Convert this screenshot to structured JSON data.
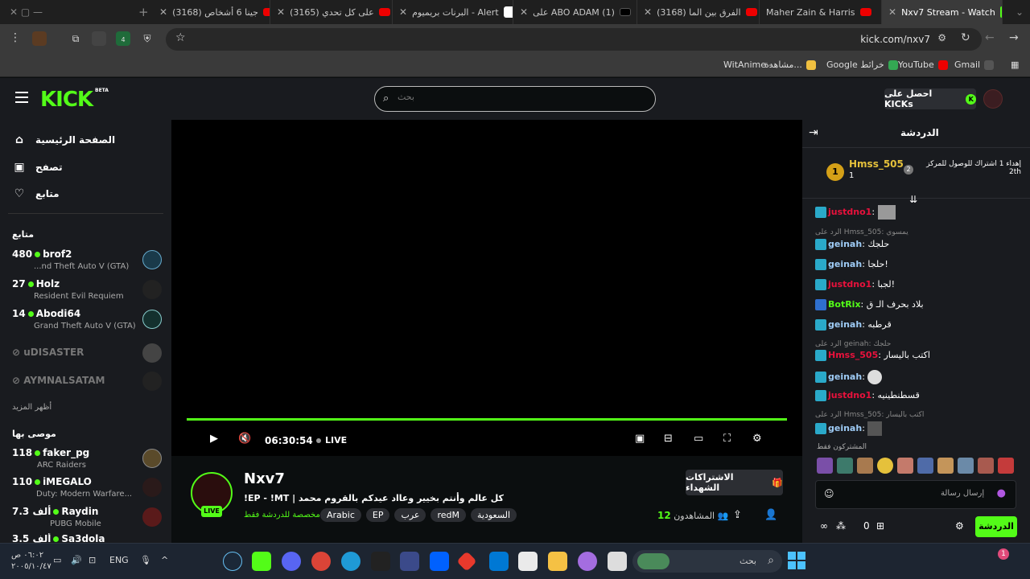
{
  "browser": {
    "tabs": [
      {
        "label": "جينا 6 أشخاص (3168)",
        "icon": "youtube-icon"
      },
      {
        "label": "على كل تحدي (3165)",
        "icon": "youtube-icon"
      },
      {
        "label": "البرنات بريميوم - Alert",
        "icon": "app-icon"
      },
      {
        "label": "على ABO ADAM (1)",
        "icon": "x-icon"
      },
      {
        "label": "الفرق بين الما (3168)",
        "icon": "youtube-icon"
      },
      {
        "label": "Maher Zain & Harris",
        "icon": "youtube-icon"
      },
      {
        "label": "Nxv7 Stream - Watch",
        "icon": "kick-icon"
      }
    ],
    "url": "kick.com/nxv7",
    "extension_badge": "4",
    "bookmarks": [
      {
        "label": "Gmail"
      },
      {
        "label": "YouTube"
      },
      {
        "label": "Google خرائط"
      },
      {
        "label": "مشاهدة..."
      },
      {
        "label": "WitAnime -"
      }
    ]
  },
  "kick": {
    "logo": "KICK",
    "beta": "BETA",
    "search_placeholder": "بحث",
    "get_kicks": "احصل على KICKs",
    "nav": {
      "home": "الصفحة الرئيسية",
      "browse": "تصفح",
      "following": "متابع"
    },
    "following_header": "متابع",
    "following": [
      {
        "count": "480",
        "name": "brof2",
        "game": "...nd Theft Auto V (GTA)"
      },
      {
        "count": "27",
        "name": "Holz",
        "game": "Resident Evil Requiem"
      },
      {
        "count": "14",
        "name": "Abodi64",
        "game": "Grand Theft Auto V (GTA)"
      }
    ],
    "offline": [
      "uDISASTER",
      "AYMNALSATAM"
    ],
    "show_more": "أظهر المزيد",
    "recommended_header": "موصى بها",
    "recommended": [
      {
        "count": "118",
        "name": "faker_pg",
        "game": "ARC Raiders"
      },
      {
        "count": "110",
        "name": "iMEGALO",
        "game": "Duty: Modern Warfare..."
      },
      {
        "count": "7.3 ألف",
        "name": "Raydin",
        "game": "PUBG Mobile"
      },
      {
        "count": "3.5 ألف",
        "name": "Sa3dola",
        "game": ""
      }
    ],
    "player": {
      "time": "06:30:54",
      "live": "LIVE"
    },
    "stream": {
      "name": "Nxv7",
      "live_tag": "LIVE",
      "title": "!EP - !MT | كل عالم وأنتم بخيير وعااد عيدكم بالقروم محمد",
      "chat_mode": "مخصصة للدردشة فقط",
      "tags": [
        "السعودية",
        "redM",
        "عرب",
        "EP",
        "Arabic"
      ],
      "subscribe": "الاشتراكات الشهداء",
      "viewers_label": "المشاهدون",
      "viewers": "12"
    },
    "chat": {
      "title": "الدردشة",
      "pinned_user": "Hmss_505",
      "pinned_count": "1",
      "pinned_rank": "2",
      "pinned_text": "إهداء 1 اشتراك للوصول للمركز 2th",
      "messages": [
        {
          "user": "justdno1",
          "text": "",
          "color": "#e9113c"
        },
        {
          "reply": "الرد على Hmss_505: يمسوي"
        },
        {
          "user": "geinah",
          "text": "حلجك",
          "color": "#9ecbf5"
        },
        {
          "user": "geinah",
          "text": "حلجا!",
          "color": "#9ecbf5"
        },
        {
          "user": "justdno1",
          "text": "لجبا!",
          "color": "#e9113c"
        },
        {
          "user": "BotRix",
          "text": "بلاد بحرف الـ ق",
          "color": "#53fc18"
        },
        {
          "user": "geinah",
          "text": "قرطبه",
          "color": "#9ecbf5"
        },
        {
          "reply": "الرد على geinah: حلجك"
        },
        {
          "user": "Hmss_505",
          "text": "اكتب باليسار",
          "color": "#e9113c"
        },
        {
          "user": "geinah",
          "text": "",
          "color": "#9ecbf5"
        },
        {
          "user": "justdno1",
          "text": "قسطنطينيه",
          "color": "#e9113c"
        },
        {
          "reply": "الرد على Hmss_505: اكتب باليسار"
        },
        {
          "user": "geinah",
          "text": "",
          "color": "#9ecbf5"
        }
      ],
      "subs_label": "المشتركون فقط",
      "input_placeholder": "إرسال رسالة",
      "send": "الدردشة",
      "points": "0"
    }
  },
  "taskbar": {
    "search": "بحث",
    "lang": "ENG",
    "time": "٠٦:٠٢ ص",
    "date": "٢٠٠٥/١٠/٤٧",
    "notif": "1"
  }
}
